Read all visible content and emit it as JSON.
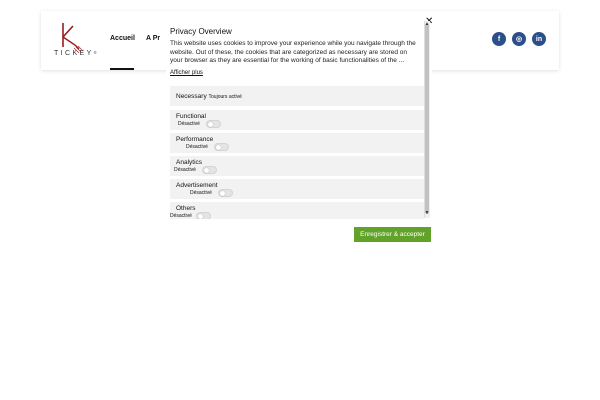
{
  "header": {
    "logo_text": "TICKEY",
    "logo_mark": "®",
    "nav": {
      "home": "Accueil",
      "about": "A Pr"
    },
    "social": {
      "facebook": "f",
      "instagram": "◎",
      "linkedin": "in"
    },
    "colors": {
      "social_bg": "#2c4f8a"
    }
  },
  "modal": {
    "close_label": "✕",
    "title": "Privacy Overview",
    "text": "This website uses cookies to improve your experience while you navigate through the website. Out of these, the cookies that are categorized as necessary are stored on your browser as they are essential for the working of basic functionalities of the ...",
    "show_more": "Afficher plus",
    "categories": [
      {
        "name": "Necessary",
        "status": "Toujours activé"
      },
      {
        "name": "Functional",
        "status": "Désactivé"
      },
      {
        "name": "Performance",
        "status": "Désactivé"
      },
      {
        "name": "Analytics",
        "status": "Désactivé"
      },
      {
        "name": "Advertisement",
        "status": "Désactivé"
      },
      {
        "name": "Others",
        "status": "Désactivé"
      }
    ],
    "save_button": "Enregistrer & accepter",
    "colors": {
      "save_bg": "#61a229",
      "category_bg": "#f2f2f2"
    }
  }
}
